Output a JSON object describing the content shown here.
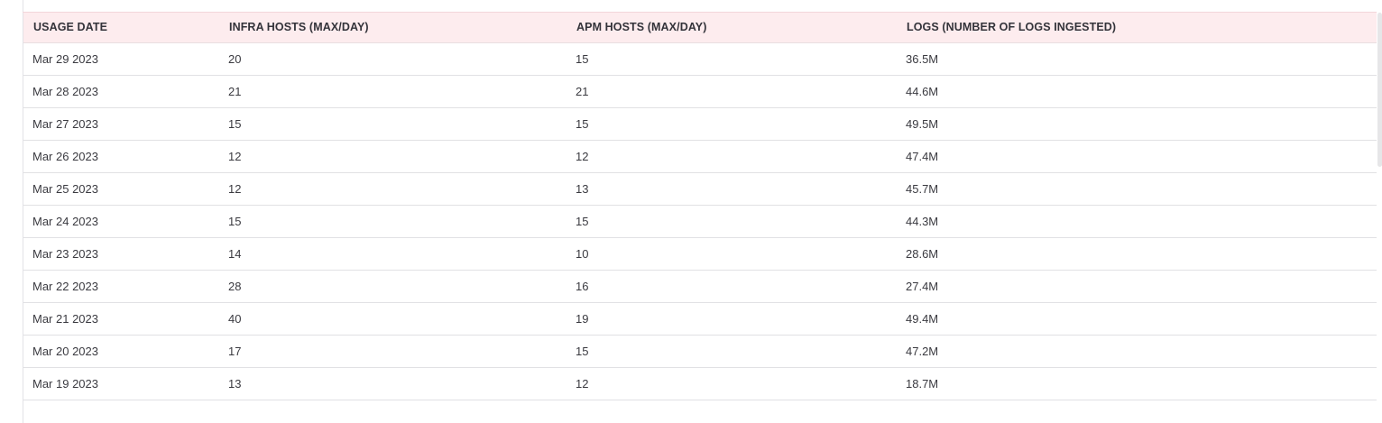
{
  "table": {
    "headers": [
      "USAGE DATE",
      "INFRA HOSTS (MAX/DAY)",
      "APM HOSTS (MAX/DAY)",
      "LOGS (NUMBER OF LOGS INGESTED)"
    ],
    "rows": [
      [
        "Mar 29 2023",
        "20",
        "15",
        "36.5M"
      ],
      [
        "Mar 28 2023",
        "21",
        "21",
        "44.6M"
      ],
      [
        "Mar 27 2023",
        "15",
        "15",
        "49.5M"
      ],
      [
        "Mar 26 2023",
        "12",
        "12",
        "47.4M"
      ],
      [
        "Mar 25 2023",
        "12",
        "13",
        "45.7M"
      ],
      [
        "Mar 24 2023",
        "15",
        "15",
        "44.3M"
      ],
      [
        "Mar 23 2023",
        "14",
        "10",
        "28.6M"
      ],
      [
        "Mar 22 2023",
        "28",
        "16",
        "27.4M"
      ],
      [
        "Mar 21 2023",
        "40",
        "19",
        "49.4M"
      ],
      [
        "Mar 20 2023",
        "17",
        "15",
        "47.2M"
      ],
      [
        "Mar 19 2023",
        "13",
        "12",
        "18.7M"
      ]
    ]
  },
  "colors": {
    "header_background": "#fdecee",
    "row_divider": "#e1e1e4",
    "text": "#3a3a40"
  }
}
